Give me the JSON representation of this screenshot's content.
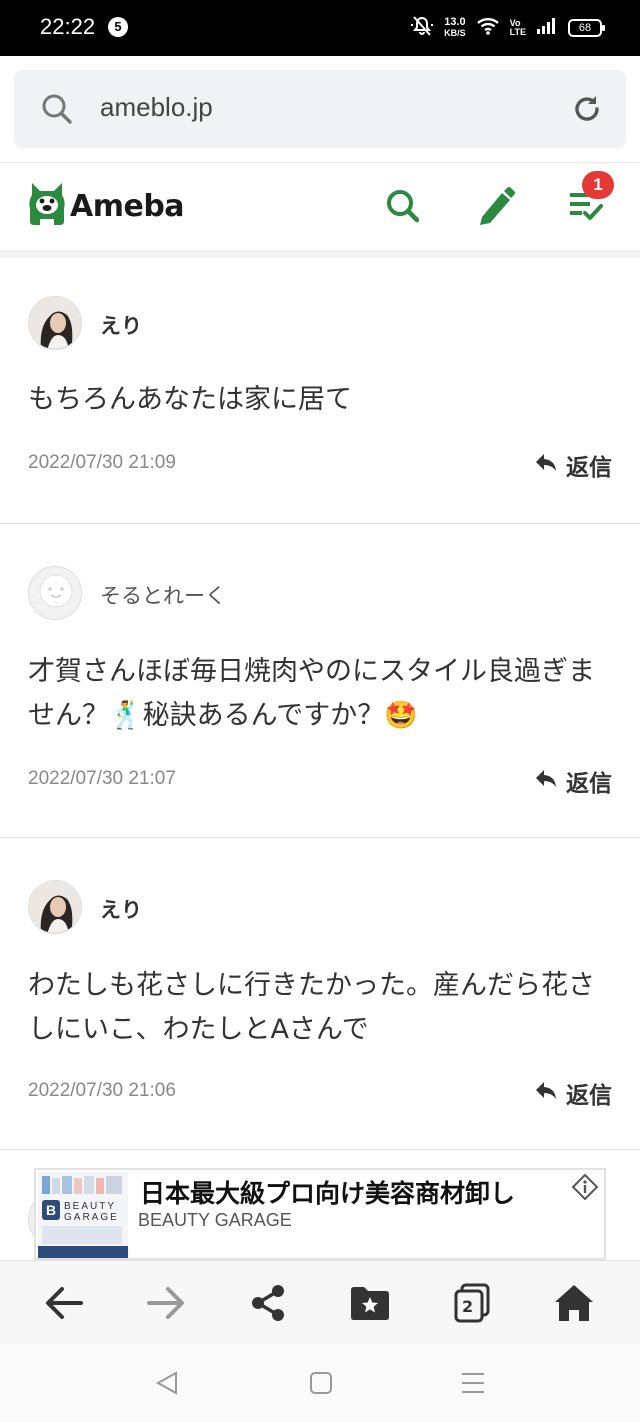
{
  "status_bar": {
    "time": "22:22",
    "notification_count": "5",
    "net_speed_value": "13.0",
    "net_speed_unit": "KB/S",
    "battery": "68"
  },
  "browser": {
    "url": "ameblo.jp",
    "tab_count": "2"
  },
  "ameba": {
    "logo_text": "Ameba",
    "notification_badge": "1",
    "brand_color": "#2b8a3e"
  },
  "comments": [
    {
      "author": "えり",
      "body": "もちろんあなたは家に居て",
      "date": "2022/07/30 21:09",
      "reply_label": "返信"
    },
    {
      "author": "そるとれーく",
      "body": "才賀さんほぼ毎日焼肉やのにスタイル良過ぎません？🕺秘訣あるんですか？🤩",
      "date": "2022/07/30 21:07",
      "reply_label": "返信"
    },
    {
      "author": "えり",
      "body": "わたしも花さしに行きたかった。産んだら花さしにいこ、わたしとAさんで",
      "date": "2022/07/30 21:06",
      "reply_label": "返信"
    }
  ],
  "ad": {
    "title": "日本最大級プロ向け美容商材卸し",
    "subtitle": "BEAUTY GARAGE",
    "logo_text_1": "BEAUTY",
    "logo_text_2": "GARAGE"
  }
}
